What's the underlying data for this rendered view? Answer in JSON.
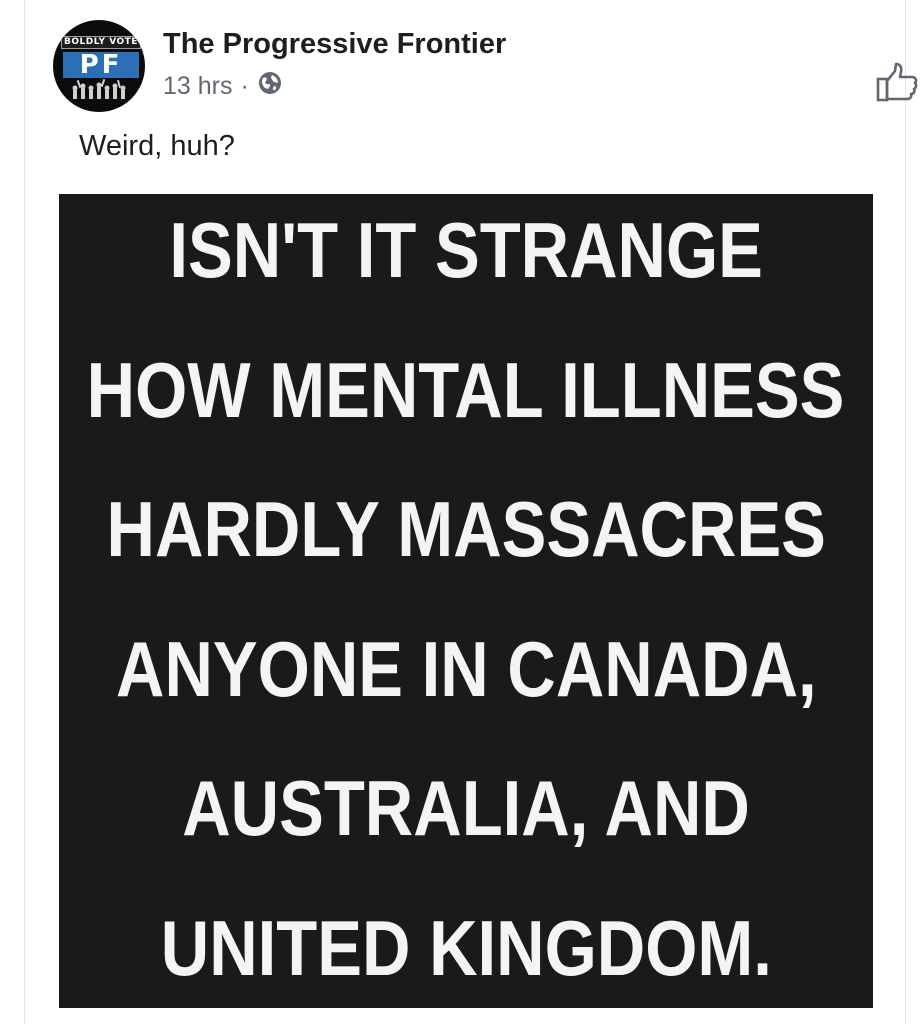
{
  "post": {
    "page_name": "The Progressive Frontier",
    "timestamp": "13 hrs",
    "separator": "·",
    "privacy_icon": "globe-icon",
    "caption": "Weird, huh?",
    "like_icon": "thumbs-up-icon"
  },
  "avatar": {
    "top_text": "BOLDLY VOTE",
    "monogram": "PF",
    "accent_color": "#2d6fb7"
  },
  "meme": {
    "background_color": "#1a1a1a",
    "text_color": "#f4f4f4",
    "lines": [
      "ISN'T IT STRANGE",
      "HOW MENTAL ILLNESS",
      "HARDLY MASSACRES",
      "ANYONE IN CANADA,",
      "AUSTRALIA, AND",
      "UNITED KINGDOM."
    ]
  }
}
